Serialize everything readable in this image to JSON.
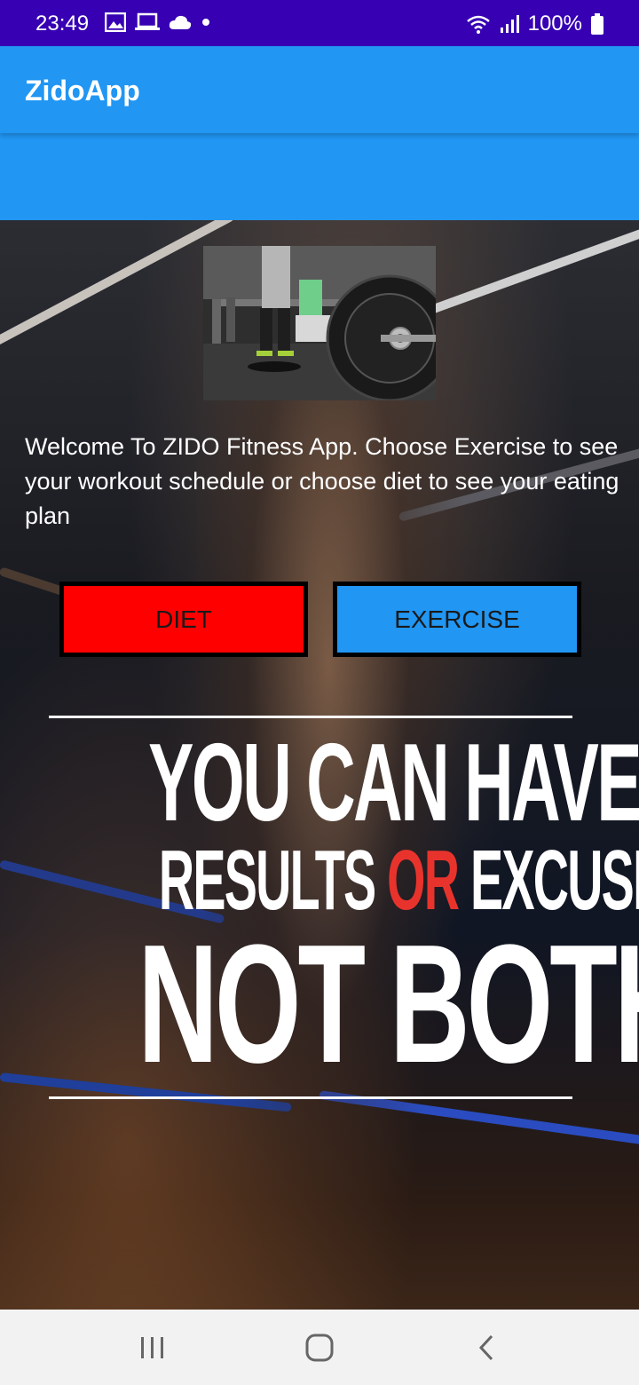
{
  "status_bar": {
    "time": "23:49",
    "battery": "100%",
    "icons": [
      "image-icon",
      "laptop-icon",
      "cloud-icon",
      "dot-icon",
      "wifi-icon",
      "signal-icon",
      "battery-icon"
    ]
  },
  "app_bar": {
    "title": "ZidoApp"
  },
  "main": {
    "welcome_text": "Welcome To ZIDO Fitness App. Choose Exercise to see your workout schedule or choose diet to see your eating plan",
    "buttons": {
      "diet": "DIET",
      "exercise": "EXERCISE"
    },
    "quote": {
      "line1": "YOU CAN HAVE",
      "line2_a": "RESULTS ",
      "line2_b": "OR",
      "line2_c": " EXCUSES",
      "line3": "NOT BOTH"
    }
  },
  "nav_bar": {
    "icons": [
      "recent-apps-icon",
      "home-icon",
      "back-icon"
    ]
  },
  "colors": {
    "status_bar": "#3700b3",
    "app_bar": "#2196f3",
    "diet_button": "#ff0000",
    "exercise_button": "#2196f3",
    "quote_accent": "#e8332d",
    "nav_bar": "#f2f2f2"
  }
}
